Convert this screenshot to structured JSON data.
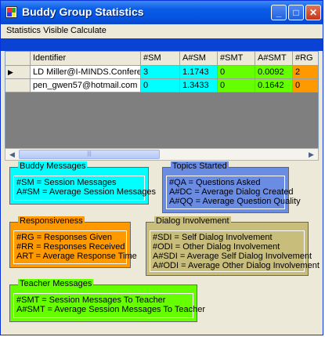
{
  "window": {
    "title": "Buddy Group Statistics",
    "minimize": "_",
    "maximize": "□",
    "close": "✕"
  },
  "menu": {
    "statistics_visible": "Statistics Visible",
    "calculate": "Calculate"
  },
  "grid": {
    "columns": [
      "Identifier",
      "#SM",
      "A#SM",
      "#SMT",
      "A#SMT",
      "#RG"
    ],
    "rows": [
      {
        "marker": "▶",
        "cells": [
          "LD Miller@I-MINDS.Confere",
          "3",
          "1.1743",
          "0",
          "0.0092",
          "2"
        ]
      },
      {
        "marker": "",
        "cells": [
          "pen_gwen57@hotmail.com",
          "0",
          "1.3433",
          "0",
          "0.1642",
          "0"
        ]
      }
    ]
  },
  "scrollbar": {
    "left": "◀",
    "right": "▶",
    "thumb": "|||"
  },
  "legends": {
    "buddy": {
      "title": "Buddy Messages",
      "lines": [
        "#SM = Session Messages",
        "A#SM = Average Session Messages"
      ]
    },
    "topics": {
      "title": "Topics Started",
      "lines": [
        "#QA = Questions Asked",
        "A#DC = Average Dialog Created",
        "A#QQ = Average Question Quality"
      ]
    },
    "responsiveness": {
      "title": "Responsiveness",
      "lines": [
        "#RG = Responses Given",
        "#RR = Responses Received",
        "ART = Average Response Time"
      ]
    },
    "dialog": {
      "title": "Dialog Involvement",
      "lines": [
        "#SDI = Self Dialog Involvement",
        "#ODI = Other Dialog Involvement",
        "A#SDI = Average Self Dialog Involvement",
        "A#ODI = Average Other Dialog Involvement"
      ]
    },
    "teacher": {
      "title": "Teacher Messages",
      "lines": [
        "#SMT = Session Messages To Teacher",
        "A#SMT = Average Session Messages To Teacher"
      ]
    }
  },
  "colors": {
    "cyan": "#00ffff",
    "blue": "#6b8ce3",
    "orange": "#ff9900",
    "khaki": "#c8bd7b",
    "green": "#66ff00",
    "titlebar": "#0a5ce6"
  }
}
